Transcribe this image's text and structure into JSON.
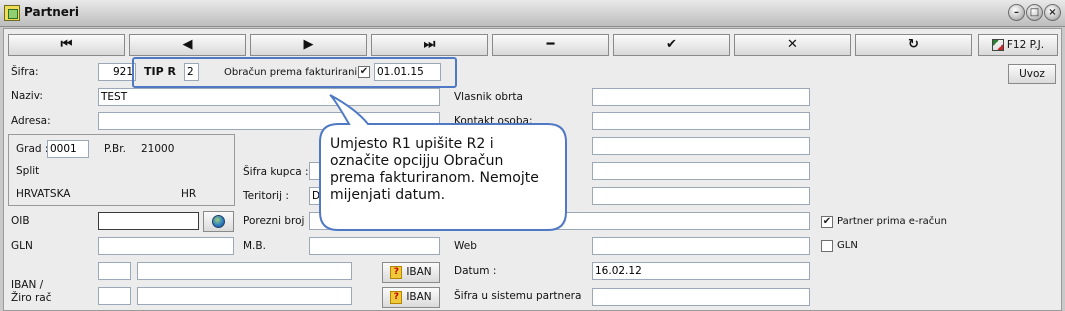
{
  "window": {
    "title": "Partneri",
    "controls": [
      "–",
      "□",
      "×"
    ]
  },
  "toolbar": {
    "nav": [
      "⏮",
      "◀",
      "▶",
      "⏭",
      "━",
      "✔",
      "✕",
      "↻"
    ],
    "f12_label": "F12 P.J."
  },
  "form": {
    "sifra_label": "Šifra:",
    "sifra_value": "921",
    "tip_label": "TIP R",
    "tip_value": "2",
    "obracun_label": "Obračun prema fakturiranim",
    "obracun_checked": "✔",
    "obracun_date": "01.01.15",
    "uvoz_label": "Uvoz",
    "naziv_label": "Naziv:",
    "naziv_value": "TEST",
    "adresa_label": "Adresa:",
    "vlasnik_label": "Vlasnik obrta",
    "kontakt_label": "Kontakt osoba:",
    "grad_label": "Grad :",
    "grad_value": "0001",
    "pbr_label": "P.Br.",
    "pbr_value": "21000",
    "city": "Split",
    "country": "HRVATSKA",
    "country_code": "HR",
    "sifra_kupca_label": "Šifra kupca :",
    "teritorij_label": "Teritorij :",
    "teritorij_value": "D",
    "oib_label": "OIB",
    "porezni_label": "Porezni broj :",
    "partner_eracun_label": "Partner prima e-račun",
    "partner_eracun_checked": "✔",
    "gln_label": "GLN",
    "mb_label": "M.B.",
    "web_label": "Web",
    "gln_chk_label": "GLN",
    "iban_label": "IBAN /",
    "ziro_label": "Žiro rač",
    "iban_btn": "IBAN",
    "iban_help": "?",
    "datum_label": "Datum :",
    "datum_value": "16.02.12",
    "sifra_sustav_label": "Šifra u sistemu partnera"
  },
  "callout": {
    "lines": [
      "Umjesto R1 upišite R2 i",
      "označite opcijju Obračun",
      "prema fakturiranom. Nemojte",
      "mijenjati datum."
    ]
  },
  "colors": {
    "highlight": "#4f79c4",
    "field_border": "#9aa8b8",
    "background": "#ececec"
  },
  "icons": {
    "globe": "globe-icon",
    "question": "question-icon",
    "f12": "network-icon"
  }
}
